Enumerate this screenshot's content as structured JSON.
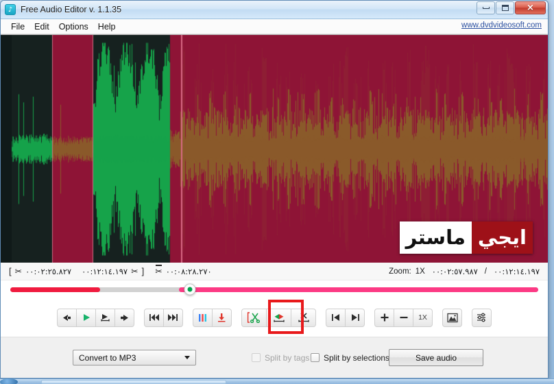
{
  "window": {
    "title": "Free Audio Editor v. 1.1.35",
    "app_icon": "music-note-icon",
    "minimize_label": "Minimize",
    "maximize_label": "Maximize",
    "close_label": "×"
  },
  "menubar": {
    "items": [
      {
        "label": "File",
        "name": "menu-file"
      },
      {
        "label": "Edit",
        "name": "menu-edit"
      },
      {
        "label": "Options",
        "name": "menu-options"
      },
      {
        "label": "Help",
        "name": "menu-help"
      }
    ],
    "site_link": "www.dvdvideosoft.com"
  },
  "waveform": {
    "watermark_red_text": "ايجي",
    "watermark_white_text": "ماستر",
    "colors": {
      "background": "#16211f",
      "selection": "#8e1436",
      "wave_green": "#16a34a",
      "wave_in_selection": "#8a5a2a",
      "cursor": "#d96a86"
    }
  },
  "info_strip": {
    "selection_start": "٠٠:٠٢:٢٥.٨٢٧",
    "selection_end": "٠٠:١٢:١٤.١٩٧",
    "selection_length": "٠٠:٠٨:٢٨.٢٧٠",
    "bracket_open": "[",
    "bracket_close": "]",
    "scissors_icon": "✂",
    "zoom_label": "Zoom:",
    "zoom_value": "1X",
    "position_current": "٠٠:٠٢:٥٧.٩٨٧",
    "position_separator": "/",
    "position_total": "٠٠:١٢:١٤.١٩٧"
  },
  "seekbar": {
    "played_percent": 17,
    "buffered_percent": 45,
    "handle_percent": 34,
    "colors": {
      "played": "#f01b3f",
      "track": "#d2d2d2",
      "remaining": "#fc3a84",
      "handle_dot": "#00a14b"
    }
  },
  "toolbar": {
    "groups": [
      {
        "name": "playback-group",
        "buttons": [
          {
            "name": "step-back-button",
            "icon": "arrow-left-icon",
            "label": ""
          },
          {
            "name": "play-button",
            "icon": "play-icon",
            "label": ""
          },
          {
            "name": "play-selection-button",
            "icon": "play-selection-icon",
            "label": ""
          },
          {
            "name": "step-forward-button",
            "icon": "arrow-right-icon",
            "label": ""
          }
        ]
      },
      {
        "name": "skip-group",
        "buttons": [
          {
            "name": "skip-start-button",
            "icon": "skip-to-start-icon",
            "label": ""
          },
          {
            "name": "skip-end-button",
            "icon": "skip-to-end-icon",
            "label": ""
          }
        ]
      },
      {
        "name": "marker-group",
        "buttons": [
          {
            "name": "markers-button",
            "icon": "markers-icon",
            "label": ""
          },
          {
            "name": "insert-marker-button",
            "icon": "insert-marker-icon",
            "label": ""
          }
        ]
      },
      {
        "name": "edit-group",
        "buttons": [
          {
            "name": "cut-selection-button",
            "icon": "scissors-bracket-icon",
            "label": ""
          },
          {
            "name": "trim-selection-button",
            "icon": "trim-arrows-icon",
            "label": ""
          },
          {
            "name": "delete-selection-button",
            "icon": "delete-selection-icon",
            "label": ""
          }
        ]
      },
      {
        "name": "nav-group",
        "buttons": [
          {
            "name": "goto-start-button",
            "icon": "jump-start-icon",
            "label": ""
          },
          {
            "name": "goto-end-button",
            "icon": "jump-end-icon",
            "label": ""
          }
        ]
      },
      {
        "name": "zoom-group",
        "buttons": [
          {
            "name": "zoom-in-button",
            "icon": "plus-icon",
            "label": ""
          },
          {
            "name": "zoom-out-button",
            "icon": "minus-icon",
            "label": ""
          },
          {
            "name": "zoom-reset-button",
            "icon": "",
            "label": "1X"
          }
        ]
      },
      {
        "name": "view-group",
        "buttons": [
          {
            "name": "spectrum-view-button",
            "icon": "spectrum-icon",
            "label": ""
          }
        ]
      },
      {
        "name": "settings-group",
        "buttons": [
          {
            "name": "effects-settings-button",
            "icon": "sliders-icon",
            "label": ""
          }
        ]
      }
    ],
    "highlighted_button": "trim-selection-button",
    "highlight_color": "#e8191b"
  },
  "bottombar": {
    "format_select_value": "Convert to MP3",
    "split_by_tags_label": "Split by tags",
    "split_by_tags_checked": false,
    "split_by_tags_disabled": true,
    "split_by_selections_label": "Split by selections",
    "split_by_selections_checked": false,
    "save_button_label": "Save audio"
  }
}
